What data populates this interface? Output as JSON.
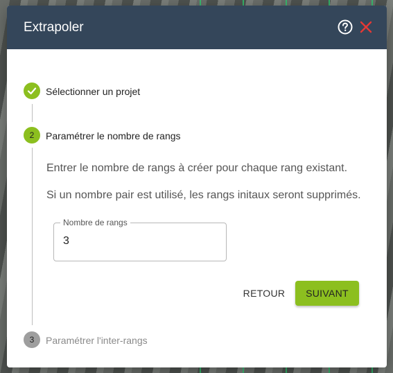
{
  "dialog": {
    "title": "Extrapoler",
    "help_icon": "help-circle-icon",
    "close_icon": "close-icon",
    "close_color": "#e53935",
    "header_color": "#34465a",
    "accent_color": "#8cbf1f"
  },
  "steps": [
    {
      "number": "1",
      "label": "Sélectionner un projet",
      "state": "done"
    },
    {
      "number": "2",
      "label": "Paramétrer le nombre de rangs",
      "state": "active"
    },
    {
      "number": "3",
      "label": "Paramétrer l'inter-rangs",
      "state": "inactive"
    }
  ],
  "step2": {
    "description_1": "Entrer le nombre de rangs à créer pour chaque rang existant.",
    "description_2": "Si un nombre pair est utilisé, les rangs initaux seront supprimés.",
    "field_label": "Nombre de rangs",
    "field_value": "3",
    "back_label": "RETOUR",
    "next_label": "SUIVANT"
  }
}
